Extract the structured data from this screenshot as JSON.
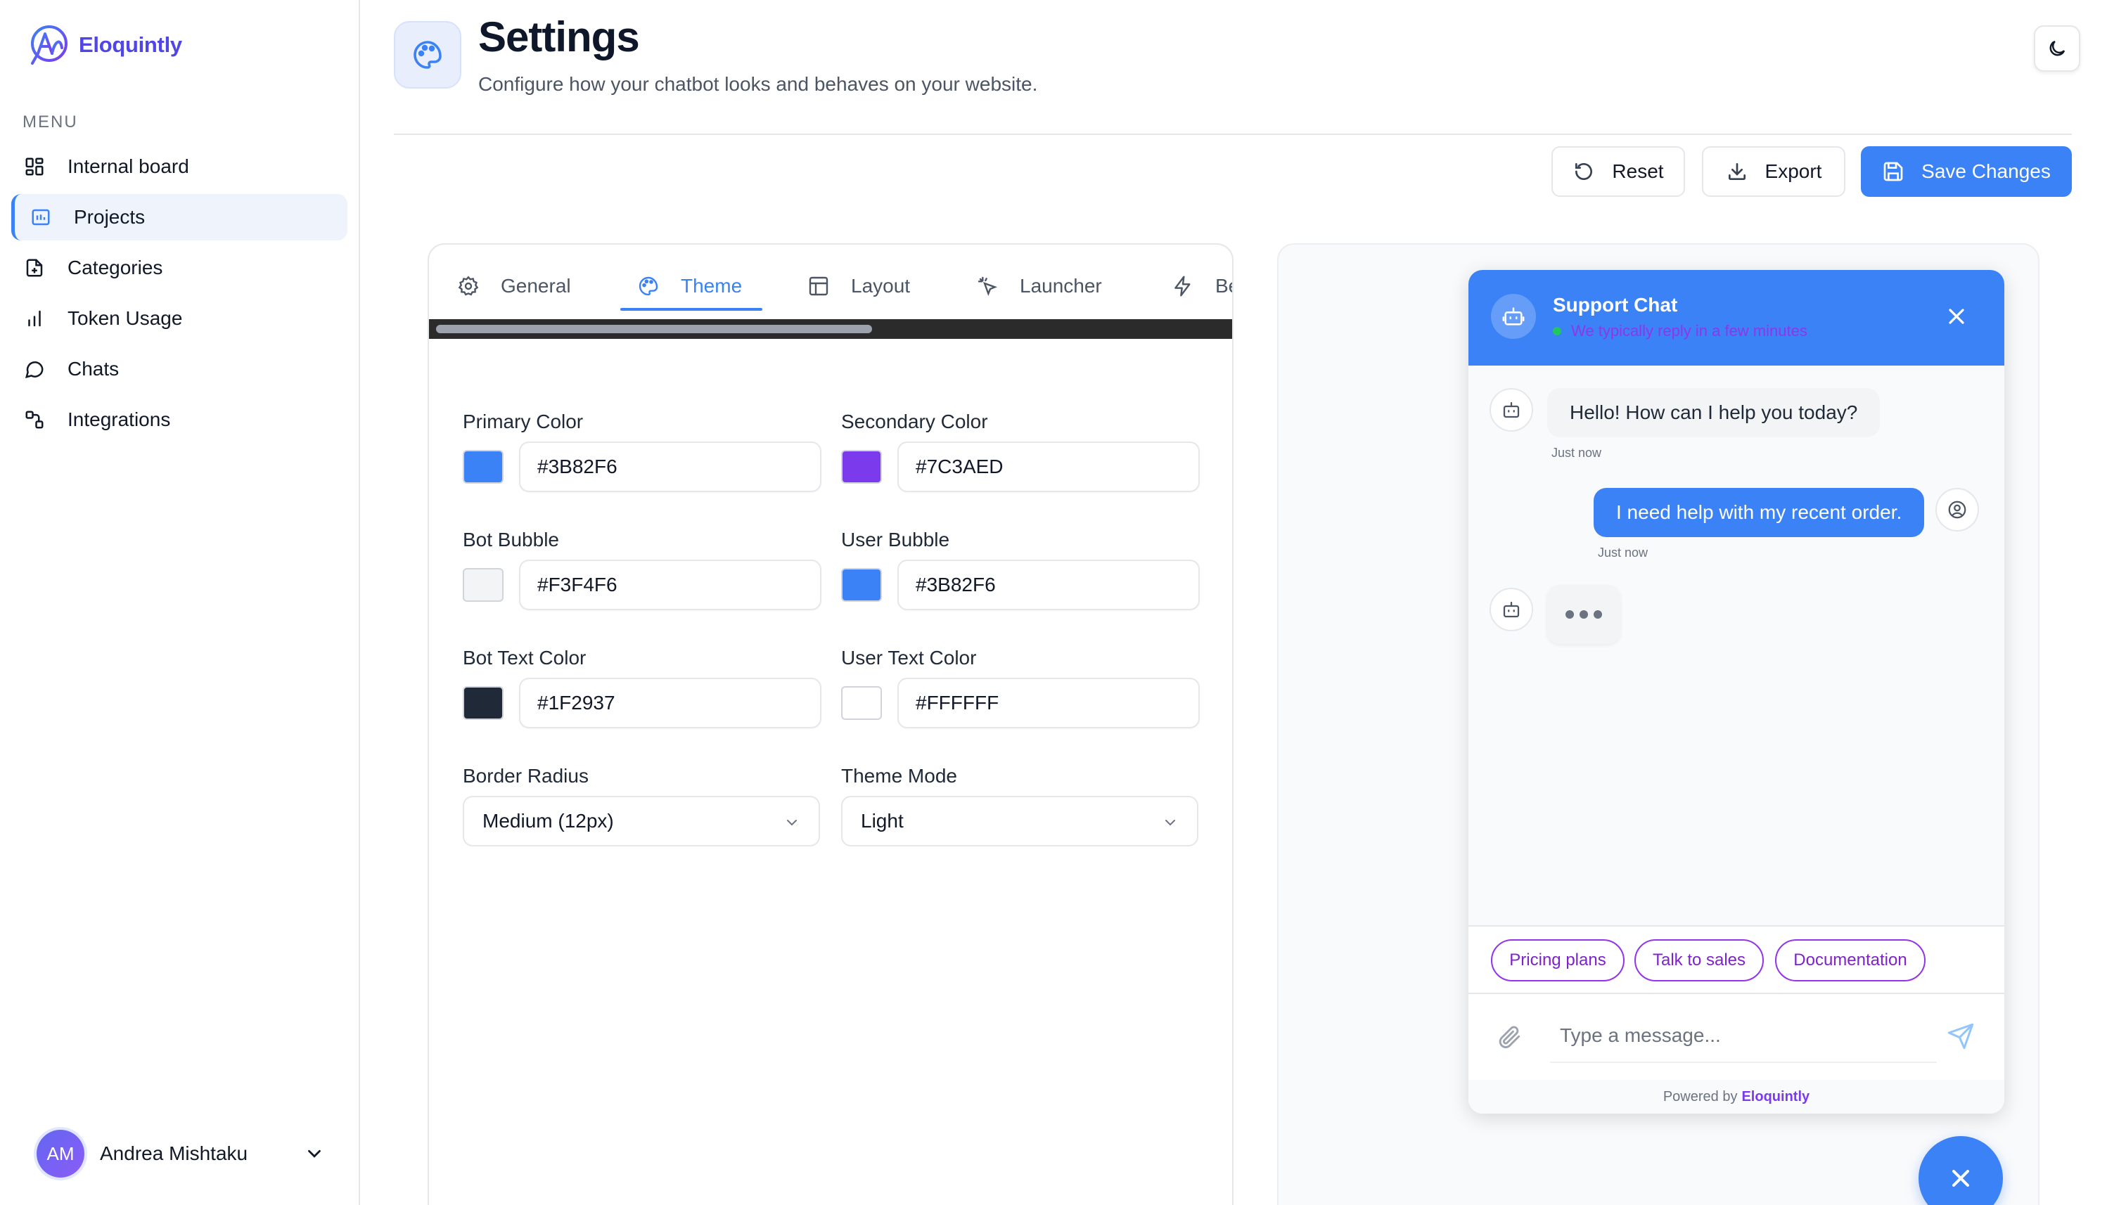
{
  "app": {
    "name": "Eloquintly"
  },
  "sidebar": {
    "menu_label": "MENU",
    "items": [
      {
        "label": "Internal board",
        "icon": "grid-icon"
      },
      {
        "label": "Projects",
        "icon": "projects-icon",
        "active": true
      },
      {
        "label": "Categories",
        "icon": "file-icon"
      },
      {
        "label": "Token Usage",
        "icon": "bar-chart-icon"
      },
      {
        "label": "Chats",
        "icon": "chat-bubble-icon"
      },
      {
        "label": "Integrations",
        "icon": "integrations-icon"
      }
    ],
    "user": {
      "initials": "AM",
      "name": "Andrea Mishtaku"
    }
  },
  "header": {
    "title": "Settings",
    "subtitle": "Configure how your chatbot looks and behaves on your website."
  },
  "toolbar": {
    "reset_label": "Reset",
    "export_label": "Export",
    "save_label": "Save Changes"
  },
  "tabs": [
    {
      "label": "General",
      "icon": "gear-icon"
    },
    {
      "label": "Theme",
      "icon": "palette-icon",
      "active": true
    },
    {
      "label": "Layout",
      "icon": "layout-icon"
    },
    {
      "label": "Launcher",
      "icon": "sparkle-pointer-icon"
    },
    {
      "label": "Be",
      "icon": "lightning-icon"
    }
  ],
  "theme": {
    "primary_color": {
      "label": "Primary Color",
      "value": "#3B82F6",
      "swatch": "#3b82f6"
    },
    "secondary_color": {
      "label": "Secondary Color",
      "value": "#7C3AED",
      "swatch": "#7c3aed"
    },
    "bot_bubble": {
      "label": "Bot Bubble",
      "value": "#F3F4F6",
      "swatch": "#f3f4f6"
    },
    "user_bubble": {
      "label": "User Bubble",
      "value": "#3B82F6",
      "swatch": "#3b82f6"
    },
    "bot_text_color": {
      "label": "Bot Text Color",
      "value": "#1F2937",
      "swatch": "#1f2937"
    },
    "user_text_color": {
      "label": "User Text Color",
      "value": "#FFFFFF",
      "swatch": "#ffffff"
    },
    "border_radius": {
      "label": "Border Radius",
      "value": "Medium (12px)"
    },
    "theme_mode": {
      "label": "Theme Mode",
      "value": "Light"
    }
  },
  "preview": {
    "title": "Support Chat",
    "status": "We typically reply in a few minutes",
    "messages": [
      {
        "from": "bot",
        "text": "Hello! How can I help you today?",
        "time": "Just now"
      },
      {
        "from": "user",
        "text": "I need help with my recent order.",
        "time": "Just now"
      }
    ],
    "quick_replies": [
      "Pricing plans",
      "Talk to sales",
      "Documentation"
    ],
    "input_placeholder": "Type a message...",
    "powered_prefix": "Powered by",
    "powered_brand": "Eloquintly"
  }
}
